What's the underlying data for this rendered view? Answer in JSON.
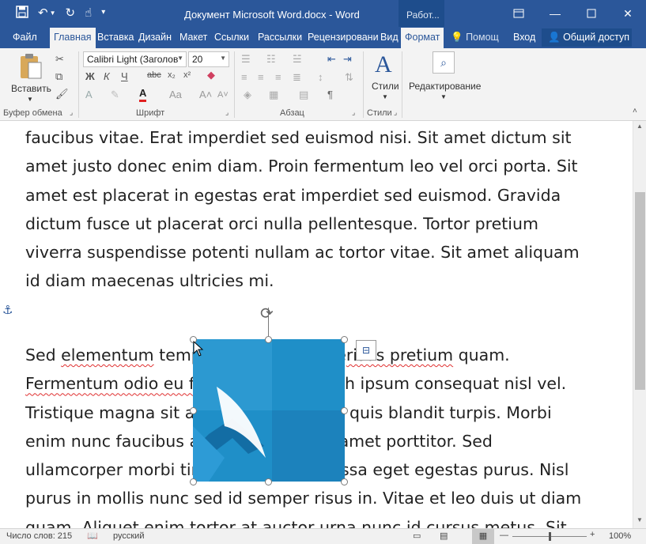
{
  "titlebar": {
    "title": "Документ Microsoft Word.docx  -  Word",
    "context_tab": "Работ...",
    "qat": [
      "save-icon",
      "undo-icon",
      "redo-icon",
      "touch-mode-icon",
      "customize-icon"
    ]
  },
  "tabs": [
    "Файл",
    "Главная",
    "Вставка",
    "Дизайн",
    "Макет",
    "Ссылки",
    "Рассылки",
    "Рецензировани",
    "Вид",
    "Формат"
  ],
  "active_tab": "Главная",
  "tell_me": "Помощ",
  "sign_in": "Вход",
  "share": "Общий доступ",
  "ribbon": {
    "paste_label": "Вставить",
    "font_name": "Calibri Light (Заголов",
    "font_size": "20",
    "styles_label": "Стили",
    "editing_label": "Редактирование",
    "groups": {
      "clipboard": "Буфер обмена",
      "font": "Шрифт",
      "paragraph": "Абзац",
      "styles": "Стили"
    }
  },
  "document": {
    "paragraph1": [
      "faucibus vitae. Erat imperdiet sed euismod nisi. Sit amet dictum sit",
      "amet justo donec enim diam. Proin fermentum leo vel orci porta. Sit",
      "amet est placerat in egestas erat imperdiet sed euismod. Gravida",
      "dictum fusce ut placerat orci nulla pellentesque. Tortor pretium",
      "viverra suspendisse potenti nullam ac tortor vitae. Sit amet aliquam",
      "id diam maecenas ultricies mi."
    ],
    "p2_line1": {
      "a": "Sed ",
      "b": "elementum",
      "c": " tempus egestas sed se",
      "d": "risus pretium",
      "e": " quam."
    },
    "p2_line2": {
      "a": "Fermentum odio eu feugiat",
      "b": " pretium nibh ipsum consequat nisl vel."
    },
    "paragraph2_rest": [
      "Tristique magna sit amet purus gravida quis blandit turpis. Morbi",
      "enim nunc faucibus a pellentesque sit amet porttitor. Sed",
      "ullamcorper morbi tincidunt ornare massa eget egestas purus. Nisl",
      "purus in mollis nunc sed id semper risus in. Vitae et leo duis ut diam",
      "quam. Aliquet enim tortor at auctor urna nunc id cursus metus. Sit"
    ]
  },
  "statusbar": {
    "word_count": "Число слов: 215",
    "language": "русский",
    "zoom": "100%",
    "zoom_level": 1.0
  },
  "colors": {
    "accent": "#2b579a",
    "image": "#1f8fc8"
  }
}
